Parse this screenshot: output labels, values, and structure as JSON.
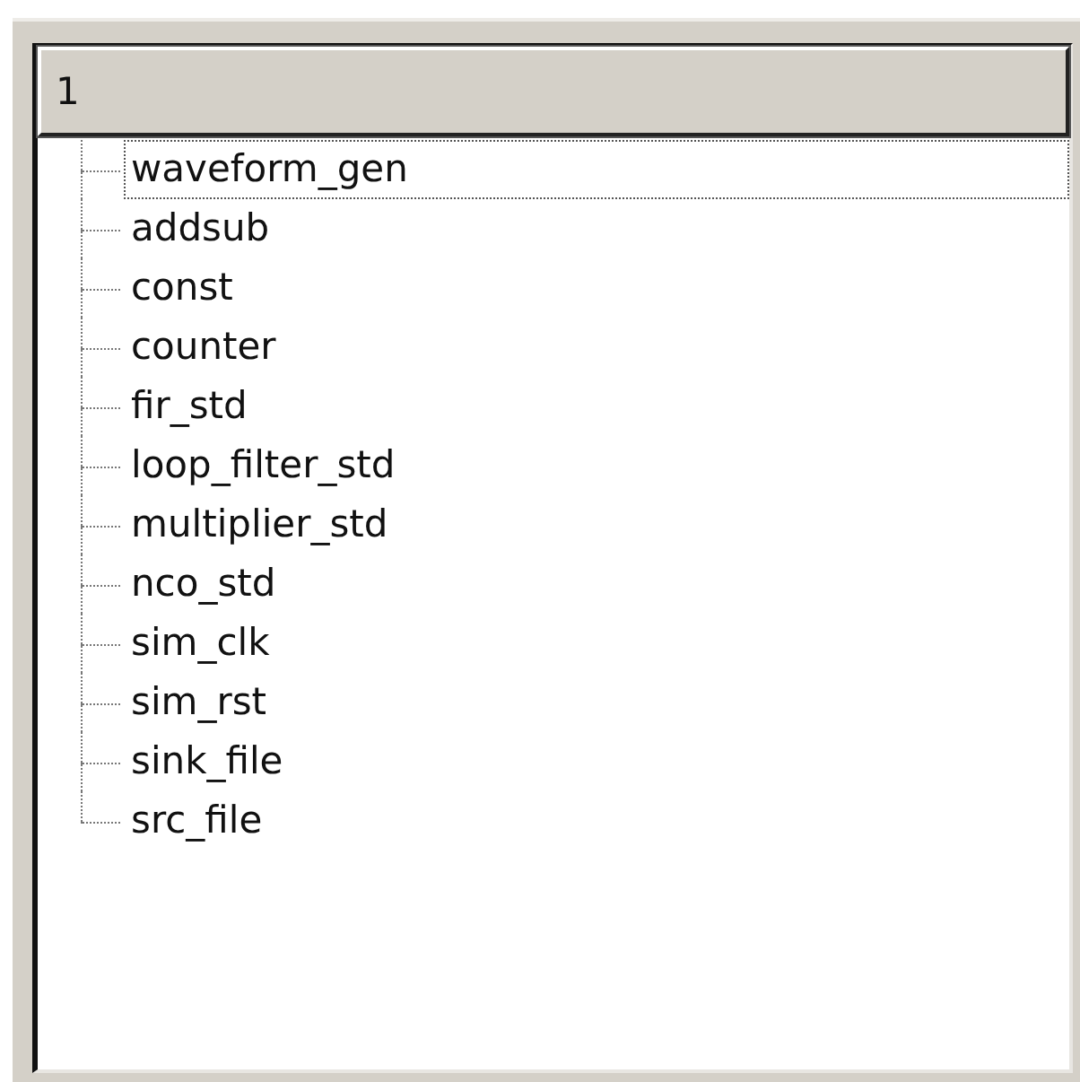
{
  "header": {
    "label": "1"
  },
  "items": [
    {
      "label": "waveform_gen",
      "selected": true
    },
    {
      "label": "addsub",
      "selected": false
    },
    {
      "label": "const",
      "selected": false
    },
    {
      "label": "counter",
      "selected": false
    },
    {
      "label": "fir_std",
      "selected": false
    },
    {
      "label": "loop_filter_std",
      "selected": false
    },
    {
      "label": "multiplier_std",
      "selected": false
    },
    {
      "label": "nco_std",
      "selected": false
    },
    {
      "label": "sim_clk",
      "selected": false
    },
    {
      "label": "sim_rst",
      "selected": false
    },
    {
      "label": "sink_file",
      "selected": false
    },
    {
      "label": "src_file",
      "selected": false
    }
  ]
}
